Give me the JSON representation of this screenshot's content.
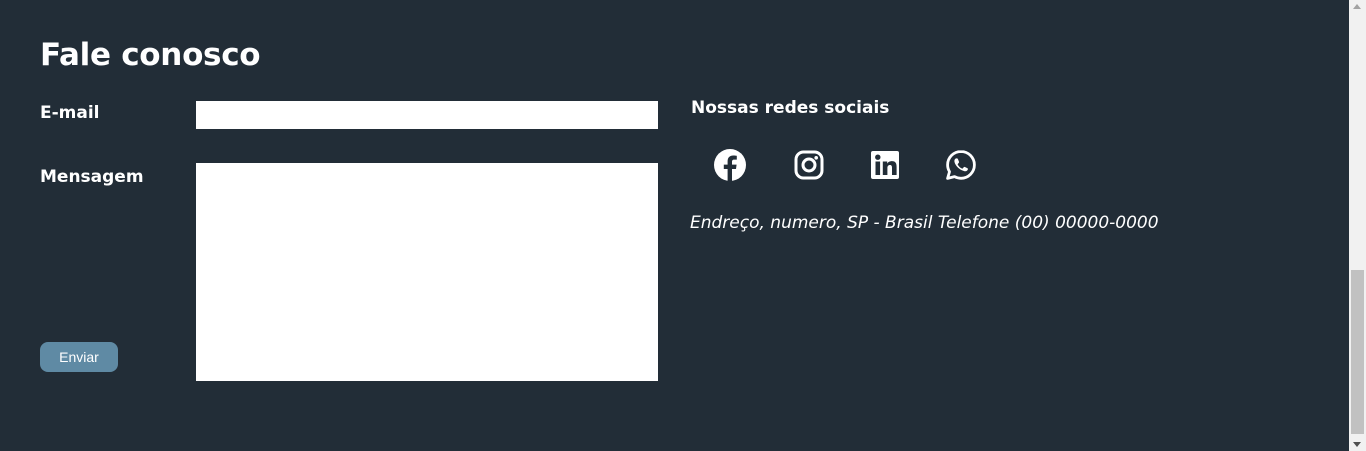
{
  "contact": {
    "title": "Fale conosco",
    "email_label": "E-mail",
    "email_value": "",
    "message_label": "Mensagem",
    "message_value": "",
    "submit_label": "Enviar"
  },
  "social": {
    "title": "Nossas redes sociais",
    "icons": [
      "facebook-icon",
      "instagram-icon",
      "linkedin-icon",
      "whatsapp-icon"
    ],
    "address": "Endreço, numero, SP - Brasil Telefone (00) 00000-0000"
  },
  "colors": {
    "background": "#222d37",
    "button": "#5f8aa4",
    "text": "#ffffff",
    "field": "#ffffff"
  }
}
